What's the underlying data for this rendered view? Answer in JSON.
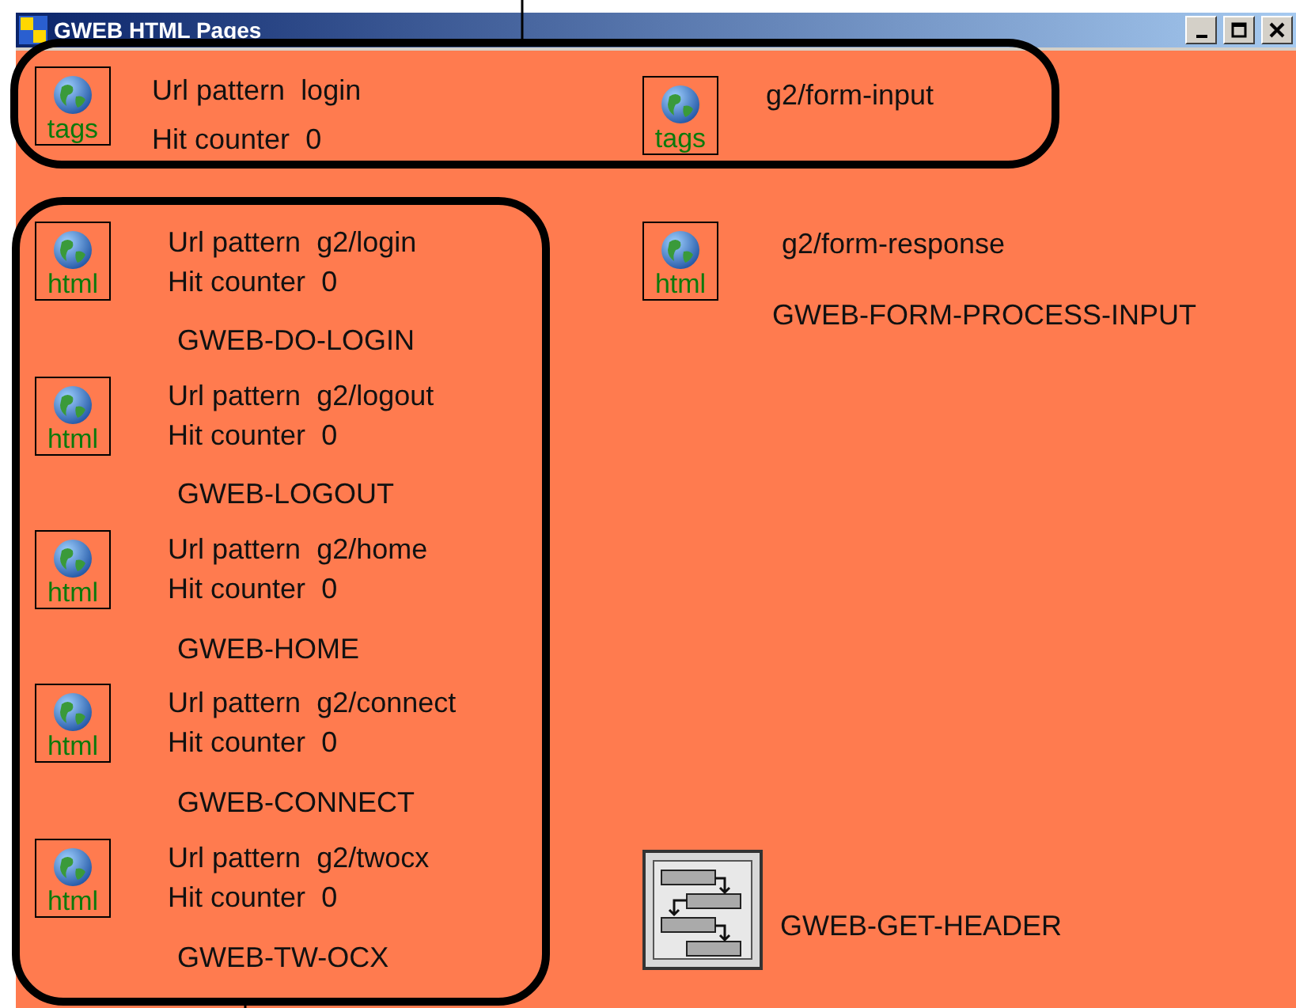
{
  "window": {
    "title": "GWEB HTML Pages",
    "controls": [
      {
        "kind": "minimize"
      },
      {
        "kind": "maximize"
      },
      {
        "kind": "close"
      }
    ]
  },
  "workspace": {
    "items": [
      {
        "kind": "page",
        "icon_label": "tags",
        "url_label": "Url pattern",
        "url": "login",
        "hit_label": "Hit counter",
        "hits": "0"
      },
      {
        "kind": "page",
        "icon_label": "tags",
        "url": "g2/form-input"
      },
      {
        "kind": "page",
        "icon_label": "html",
        "url_label": "Url pattern",
        "url": "g2/login",
        "hit_label": "Hit counter",
        "hits": "0",
        "name": "GWEB-DO-LOGIN"
      },
      {
        "kind": "page",
        "icon_label": "html",
        "url_label": "Url pattern",
        "url": "g2/logout",
        "hit_label": "Hit counter",
        "hits": "0",
        "name": "GWEB-LOGOUT"
      },
      {
        "kind": "page",
        "icon_label": "html",
        "url_label": "Url pattern",
        "url": "g2/home",
        "hit_label": "Hit counter",
        "hits": "0",
        "name": "GWEB-HOME"
      },
      {
        "kind": "page",
        "icon_label": "html",
        "url_label": "Url pattern",
        "url": "g2/connect",
        "hit_label": "Hit counter",
        "hits": "0",
        "name": "GWEB-CONNECT"
      },
      {
        "kind": "page",
        "icon_label": "html",
        "url_label": "Url pattern",
        "url": "g2/twocx",
        "hit_label": "Hit counter",
        "hits": "0",
        "name": "GWEB-TW-OCX"
      },
      {
        "kind": "page",
        "icon_label": "html",
        "url": "g2/form-response",
        "name": "GWEB-FORM-PROCESS-INPUT"
      },
      {
        "kind": "procedure",
        "name": "GWEB-GET-HEADER"
      }
    ]
  }
}
